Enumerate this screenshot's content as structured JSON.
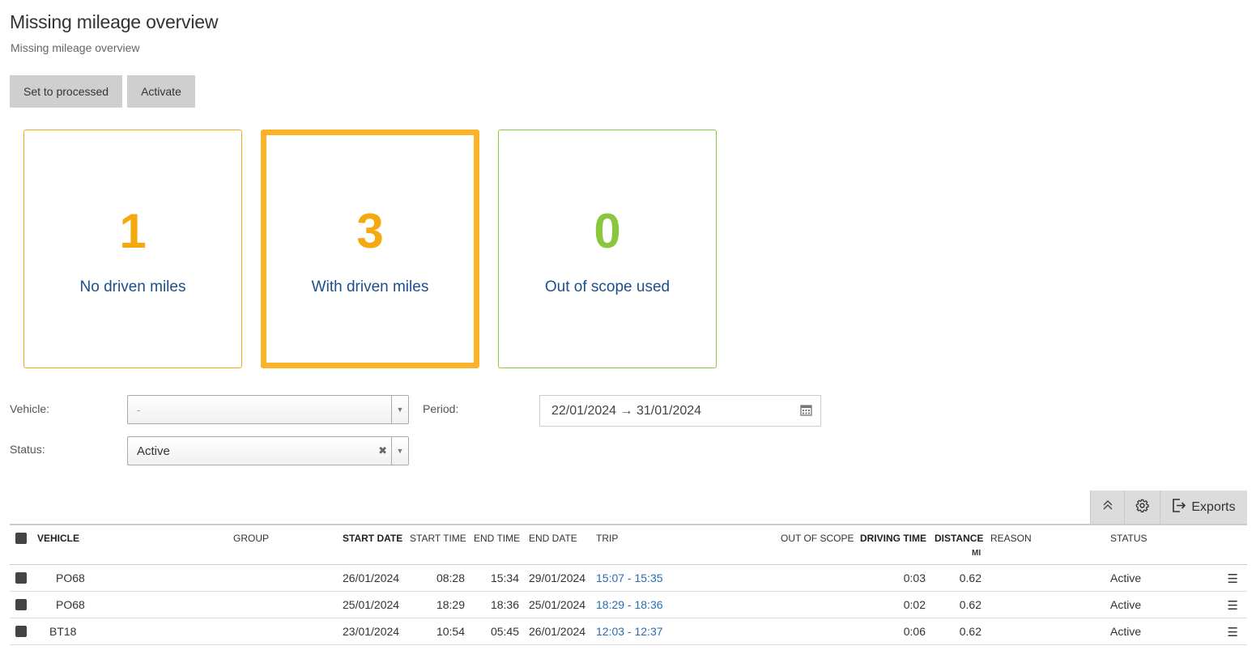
{
  "page": {
    "title": "Missing mileage overview",
    "subtitle": "Missing mileage overview"
  },
  "toolbar": {
    "set_processed_label": "Set to processed",
    "activate_label": "Activate"
  },
  "tiles": [
    {
      "count": "1",
      "label": "No driven miles",
      "color": "#f5a90e"
    },
    {
      "count": "3",
      "label": "With driven miles",
      "color": "#f5a90e",
      "selected": true
    },
    {
      "count": "0",
      "label": "Out of scope used",
      "color": "#8cc63e"
    }
  ],
  "filters": {
    "vehicle_label": "Vehicle:",
    "vehicle_value": "-",
    "period_label": "Period:",
    "period_value": "22/01/2024 → 31/01/2024",
    "status_label": "Status:",
    "status_value": "Active"
  },
  "grid_tools": {
    "exports_label": "Exports"
  },
  "table": {
    "columns": {
      "vehicle": "VEHICLE",
      "group": "GROUP",
      "start_date": "START DATE",
      "start_time": "START TIME",
      "end_time": "END TIME",
      "end_date": "END DATE",
      "trip": "TRIP",
      "out_of_scope": "OUT OF SCOPE",
      "driving_time": "DRIVING TIME",
      "distance": "DISTANCE",
      "distance_unit": "MI",
      "reason": "REASON",
      "status": "STATUS"
    },
    "rows": [
      {
        "vehicle": "PO68",
        "group": "",
        "start_date": "26/01/2024",
        "start_time": "08:28",
        "end_time": "15:34",
        "end_date": "29/01/2024",
        "trip": "15:07 - 15:35",
        "out_of_scope": "",
        "driving_time": "0:03",
        "distance": "0.62",
        "reason": "",
        "status": "Active"
      },
      {
        "vehicle": "PO68",
        "group": "",
        "start_date": "25/01/2024",
        "start_time": "18:29",
        "end_time": "18:36",
        "end_date": "25/01/2024",
        "trip": "18:29 - 18:36",
        "out_of_scope": "",
        "driving_time": "0:02",
        "distance": "0.62",
        "reason": "",
        "status": "Active"
      },
      {
        "vehicle": "BT18",
        "group": "",
        "start_date": "23/01/2024",
        "start_time": "10:54",
        "end_time": "05:45",
        "end_date": "26/01/2024",
        "trip": "12:03 - 12:37",
        "out_of_scope": "",
        "driving_time": "0:06",
        "distance": "0.62",
        "reason": "",
        "status": "Active"
      }
    ]
  },
  "icons": {
    "collapse": "double-chevron-up-icon",
    "settings": "gear-icon",
    "exports": "export-icon",
    "calendar": "calendar-icon",
    "row_menu": "hamburger-menu-icon"
  }
}
